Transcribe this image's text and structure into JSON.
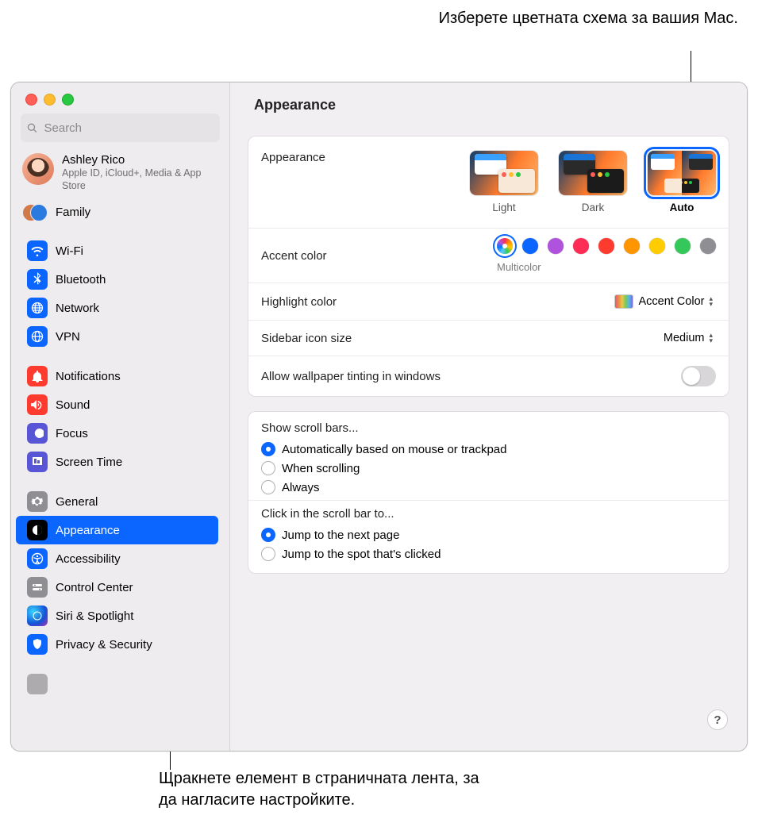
{
  "callouts": {
    "top": "Изберете цветната схема за вашия Mac.",
    "bottom": "Щракнете елемент в страничната лента, за да нагласите настройките."
  },
  "sidebar": {
    "search_placeholder": "Search",
    "user": {
      "name": "Ashley Rico",
      "subtitle": "Apple ID, iCloud+, Media & App Store"
    },
    "family_label": "Family",
    "groups": [
      [
        {
          "id": "wifi",
          "label": "Wi-Fi",
          "color": "#0a66ff"
        },
        {
          "id": "bluetooth",
          "label": "Bluetooth",
          "color": "#0a66ff"
        },
        {
          "id": "network",
          "label": "Network",
          "color": "#0a66ff"
        },
        {
          "id": "vpn",
          "label": "VPN",
          "color": "#0a66ff"
        }
      ],
      [
        {
          "id": "notifications",
          "label": "Notifications",
          "color": "#ff3b30"
        },
        {
          "id": "sound",
          "label": "Sound",
          "color": "#ff3b30"
        },
        {
          "id": "focus",
          "label": "Focus",
          "color": "#5856d6"
        },
        {
          "id": "screentime",
          "label": "Screen Time",
          "color": "#5856d6"
        }
      ],
      [
        {
          "id": "general",
          "label": "General",
          "color": "#8e8e93"
        },
        {
          "id": "appearance",
          "label": "Appearance",
          "color": "#000000",
          "selected": true
        },
        {
          "id": "accessibility",
          "label": "Accessibility",
          "color": "#0a66ff"
        },
        {
          "id": "controlcenter",
          "label": "Control Center",
          "color": "#8e8e93"
        },
        {
          "id": "siri",
          "label": "Siri & Spotlight",
          "color": "#000000"
        },
        {
          "id": "privacy",
          "label": "Privacy & Security",
          "color": "#0a66ff"
        }
      ]
    ]
  },
  "header": {
    "title": "Appearance"
  },
  "appearance": {
    "row_label": "Appearance",
    "options": {
      "light": "Light",
      "dark": "Dark",
      "auto": "Auto"
    },
    "selected": "auto"
  },
  "accent": {
    "row_label": "Accent color",
    "caption": "Multicolor",
    "colors": [
      "multicolor",
      "#0a66ff",
      "#af52de",
      "#ff2d55",
      "#ff3b30",
      "#ff9500",
      "#ffcc00",
      "#34c759",
      "#8e8e93"
    ],
    "selected_index": 0
  },
  "highlight": {
    "row_label": "Highlight color",
    "value": "Accent Color"
  },
  "sidebar_size": {
    "row_label": "Sidebar icon size",
    "value": "Medium"
  },
  "tinting": {
    "row_label": "Allow wallpaper tinting in windows",
    "enabled": false
  },
  "scrollbars": {
    "title": "Show scroll bars...",
    "options": [
      "Automatically based on mouse or trackpad",
      "When scrolling",
      "Always"
    ],
    "selected_index": 0
  },
  "scrollclick": {
    "title": "Click in the scroll bar to...",
    "options": [
      "Jump to the next page",
      "Jump to the spot that's clicked"
    ],
    "selected_index": 0
  },
  "help_label": "?"
}
